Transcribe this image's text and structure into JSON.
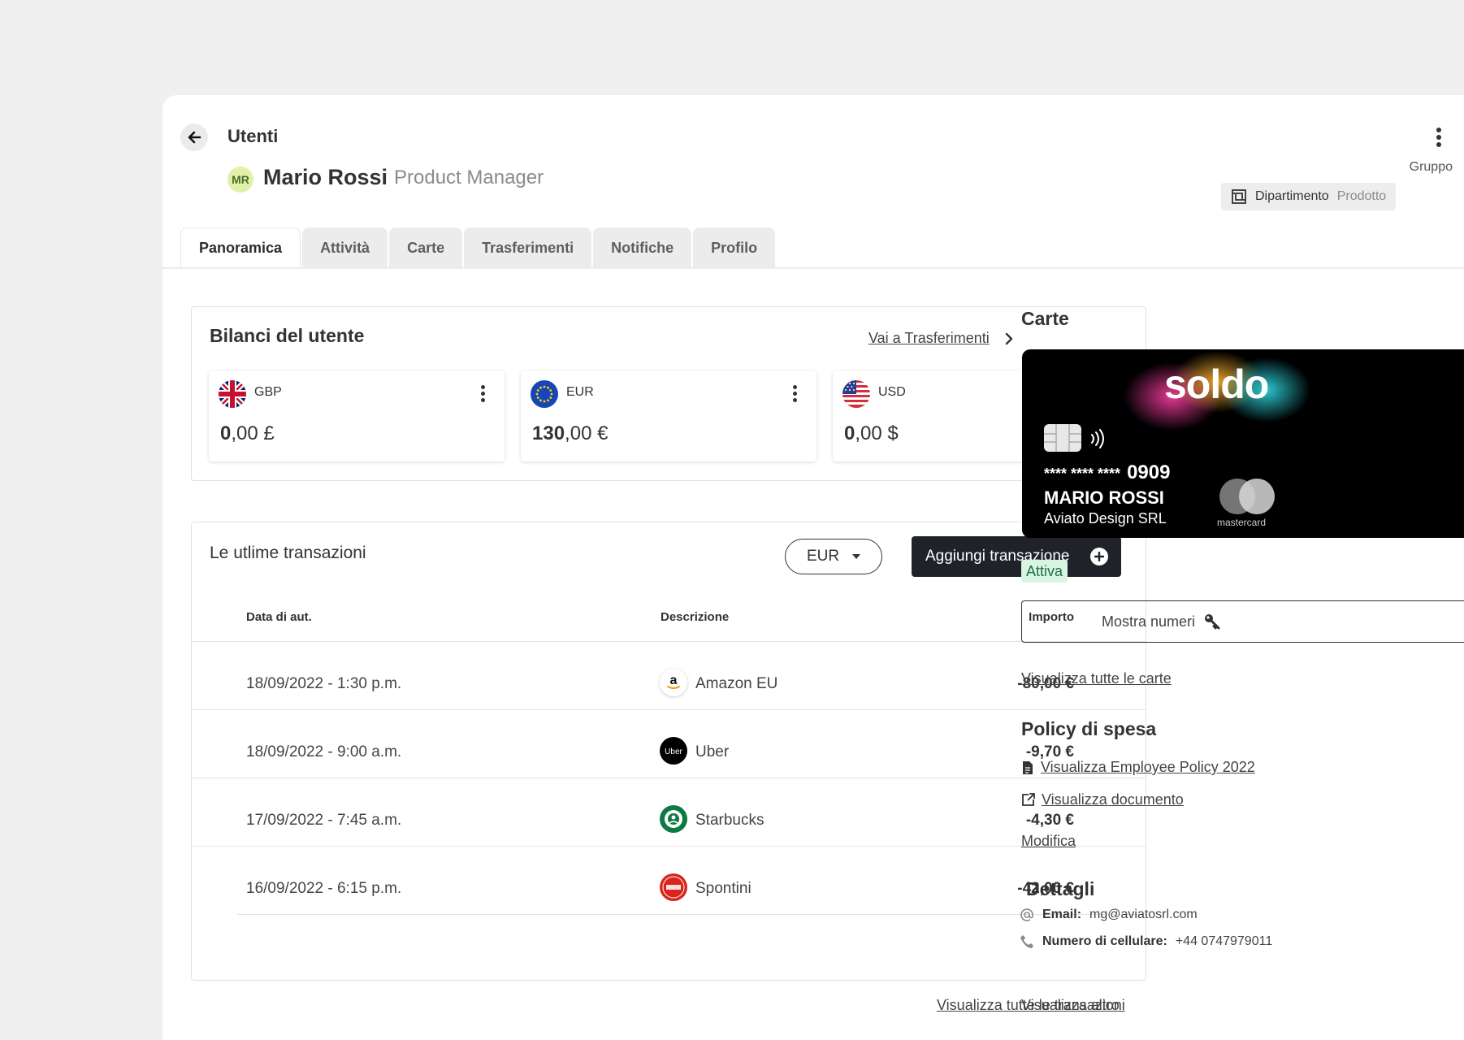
{
  "header": {
    "breadcrumb": "Utenti",
    "user": {
      "initials": "MR",
      "name": "Mario Rossi",
      "role": "Product Manager"
    },
    "group": {
      "label": "Gruppo",
      "department_name": "Dipartimento",
      "department_value": "Prodotto"
    }
  },
  "tabs": [
    {
      "label": "Panoramica",
      "active": true
    },
    {
      "label": "Attività",
      "active": false
    },
    {
      "label": "Carte",
      "active": false
    },
    {
      "label": "Trasferimenti",
      "active": false
    },
    {
      "label": "Notifiche",
      "active": false
    },
    {
      "label": "Profilo",
      "active": false
    }
  ],
  "balances": {
    "title": "Bilanci del utente",
    "link": "Vai a Trasferimenti",
    "items": [
      {
        "code": "GBP",
        "whole": "0",
        "rest": ",00 £",
        "flag": "uk-flag-icon"
      },
      {
        "code": "EUR",
        "whole": "130",
        "rest": ",00 €",
        "flag": "eu-flag-icon"
      },
      {
        "code": "USD",
        "whole": "0",
        "rest": ",00 $",
        "flag": "us-flag-icon"
      }
    ]
  },
  "transactions": {
    "title": "Le utlime transazioni",
    "currency_select": "EUR",
    "add_button": "Aggiungi transazione",
    "columns": {
      "date": "Data di aut.",
      "description": "Descrizione",
      "amount": "Importo"
    },
    "rows": [
      {
        "date": "18/09/2022 - 1:30 p.m.",
        "description": "Amazon EU",
        "amount": "-80,00 €",
        "logo": "amazon-logo-icon"
      },
      {
        "date": "18/09/2022 - 9:00 a.m.",
        "description": "Uber",
        "amount": "-9,70 €",
        "logo": "uber-logo-icon"
      },
      {
        "date": "17/09/2022 - 7:45 a.m.",
        "description": "Starbucks",
        "amount": "-4,30 €",
        "logo": "starbucks-logo-icon"
      },
      {
        "date": "16/09/2022 - 6:15 p.m.",
        "description": "Spontini",
        "amount": "-42,00 €",
        "logo": "spontini-logo-icon"
      }
    ],
    "view_all": "Visualizza tutte le transazioni"
  },
  "cards": {
    "title": "Carte",
    "brand": "soldo",
    "number": "**** **** ****",
    "last4": "0909",
    "holder": "MARIO ROSSI",
    "company": "Aviato Design SRL",
    "network": "mastercard",
    "status": "Attiva",
    "show_numbers": "Mostra numeri",
    "view_all": "Visualizza tutte le carte"
  },
  "policy": {
    "title": "Policy di spesa",
    "employee_policy": "Visualizza Employee Policy 2022",
    "document": "Visualizza documento",
    "edit": "Modifica"
  },
  "details": {
    "title": "Dettagli",
    "email_label": "Email:",
    "email": "mg@aviatosrl.com",
    "phone_label": "Numero di cellulare:",
    "phone": "+44 0747979011",
    "view_more": "Visualizza altro"
  },
  "colors": {
    "page_bg": "#efefef",
    "primary_button": "#1f2329",
    "status_active_bg": "#d8f5e4",
    "avatar_bg": "#e1f1a8"
  }
}
